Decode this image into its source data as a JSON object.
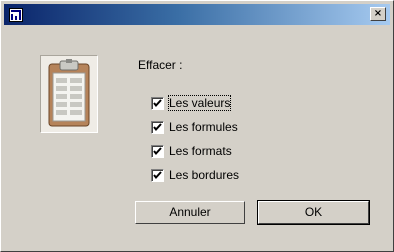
{
  "titlebar": {
    "icon": "excel-app-icon",
    "close_label": "×"
  },
  "dialog": {
    "heading": "Effacer :",
    "illustration": "clipboard-icon",
    "options": [
      {
        "label": "Les valeurs",
        "checked": true
      },
      {
        "label": "Les formules",
        "checked": true
      },
      {
        "label": "Les formats",
        "checked": true
      },
      {
        "label": "Les bordures",
        "checked": true
      }
    ],
    "buttons": {
      "cancel_label": "Annuler",
      "ok_label": "OK"
    }
  }
}
